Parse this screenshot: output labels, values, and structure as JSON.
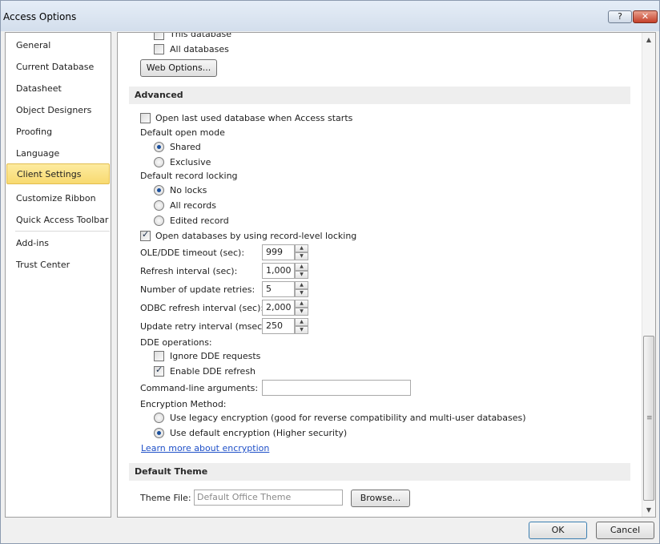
{
  "window": {
    "title": "Access Options",
    "help_label": "?",
    "close_label": "✕"
  },
  "nav": {
    "items": [
      {
        "label": "General"
      },
      {
        "label": "Current Database"
      },
      {
        "label": "Datasheet"
      },
      {
        "label": "Object Designers"
      },
      {
        "label": "Proofing"
      },
      {
        "label": "Language"
      },
      {
        "label": "Client Settings",
        "selected": true
      },
      {
        "label": "Customize Ribbon"
      },
      {
        "label": "Quick Access Toolbar"
      },
      {
        "label": "Add-ins"
      },
      {
        "label": "Trust Center"
      }
    ]
  },
  "web_options": {
    "this_database": "This database",
    "all_databases": "All databases",
    "button": "Web Options..."
  },
  "advanced": {
    "header": "Advanced",
    "open_last_used": "Open last used database when Access starts",
    "default_open_mode": "Default open mode",
    "open_mode_options": [
      "Shared",
      "Exclusive"
    ],
    "open_mode_selected": "Shared",
    "default_record_locking": "Default record locking",
    "locking_options": [
      "No locks",
      "All records",
      "Edited record"
    ],
    "locking_selected": "No locks",
    "record_level_locking": "Open databases by using record-level locking",
    "ole_timeout_label": "OLE/DDE timeout (sec):",
    "ole_timeout_value": "999",
    "refresh_interval_label": "Refresh interval (sec):",
    "refresh_interval_value": "1,000",
    "update_retries_label": "Number of update retries:",
    "update_retries_value": "5",
    "odbc_refresh_label": "ODBC refresh interval (sec):",
    "odbc_refresh_value": "2,000",
    "update_retry_interval_label": "Update retry interval (msec):",
    "update_retry_interval_value": "250",
    "dde_operations": "DDE operations:",
    "ignore_dde": "Ignore DDE requests",
    "enable_dde_refresh": "Enable DDE refresh",
    "command_line_label": "Command-line arguments:",
    "command_line_value": "",
    "encryption_method": "Encryption Method:",
    "encryption_options": [
      "Use legacy encryption (good for reverse compatibility and multi-user databases)",
      "Use default encryption (Higher security)"
    ],
    "encryption_selected": "Use default encryption (Higher security)",
    "learn_more_link": "Learn more about encryption"
  },
  "theme": {
    "header": "Default Theme",
    "theme_file_label": "Theme File:",
    "theme_file_placeholder": "Default Office Theme",
    "browse_button": "Browse..."
  },
  "footer": {
    "ok": "OK",
    "cancel": "Cancel"
  },
  "states": {
    "all_databases_checked": false,
    "open_last_used_checked": false,
    "record_level_locking_checked": true,
    "ignore_dde_checked": false,
    "enable_dde_refresh_checked": true
  },
  "icons": {
    "check": "✓",
    "spin_up": "▲",
    "spin_down": "▼",
    "scroll_up": "▲",
    "scroll_down": "▼",
    "scroll_grip": "≡"
  }
}
